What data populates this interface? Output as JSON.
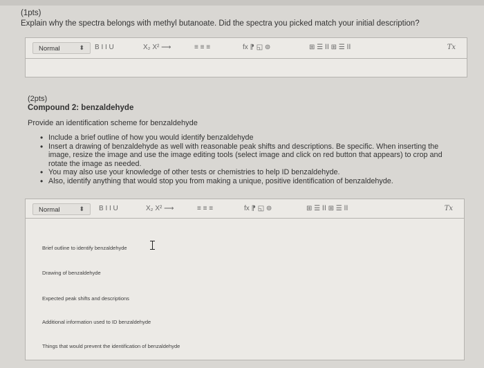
{
  "q1": {
    "points": "(1pts)",
    "question": "Explain why the spectra belongs with methyl butanoate. Did the spectra you picked match your initial description?"
  },
  "toolbar": {
    "format_value": "Normal",
    "format_arrow": "⬍",
    "text_styles": "B I I U",
    "scripts": "X₂ X² ⟶",
    "lists": "≡ ≡ ≡",
    "insert": "fx ⁋ ◱ ⊚",
    "table": "⊞ ☰ ⅠⅠ ⊞ ☰ ⅠⅠ",
    "clear": "Tx"
  },
  "q2": {
    "points": "(2pts)",
    "title": "Compound 2: benzaldehyde",
    "prompt": "Provide an identification scheme for benzaldehyde",
    "bullets": [
      "Include a brief outline of how you would identify benzaldehyde",
      "Insert a drawing of benzaldehyde as well with reasonable peak shifts and descriptions. Be specific. When inserting the image, resize the image and use the image editing tools (select image and click on red button that appears) to crop and rotate the image as needed.",
      "You may also use your knowledge of other tests or chemistries to help ID benzaldehyde.",
      "Also, identify anything that would stop you from making a unique, positive identification of benzaldehyde."
    ]
  },
  "answer": {
    "lines": [
      "Brief outline to identify benzaldehyde",
      "Drawing of benzaldehyde",
      "Expected peak shifts and descriptions",
      "Additional information used to ID benzaldehyde",
      "Things that would prevent the identification of benzaldehyde"
    ]
  }
}
